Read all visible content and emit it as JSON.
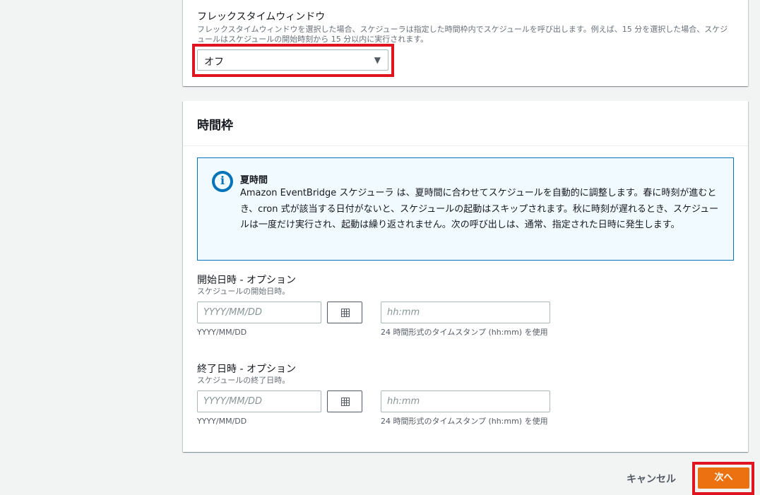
{
  "flex_window": {
    "label": "フレックスタイムウィンドウ",
    "description": "フレックスタイムウィンドウを選択した場合、スケジューラは指定した時間枠内でスケジュールを呼び出します。例えば、15 分を選択した場合、スケジュールはスケジュールの開始時刻から 15 分以内に実行されます。",
    "selected_value": "オフ",
    "caret_icon": "caret-down-icon"
  },
  "time_frame": {
    "title": "時間枠",
    "alert": {
      "icon": "info-icon",
      "icon_glyph": "i",
      "title": "夏時間",
      "body": "Amazon EventBridge スケジューラ は、夏時間に合わせてスケジュールを自動的に調整します。春に時刻が進むとき、cron 式が該当する日付がないと、スケジュールの起動はスキップされます。秋に時刻が遅れるとき、スケジュールは一度だけ実行され、起動は繰り返されません。次の呼び出しは、通常、指定された日時に発生します。"
    },
    "start": {
      "label": "開始日時 - オプション",
      "description": "スケジュールの開始日時。",
      "date_placeholder": "YYYY/MM/DD",
      "date_hint": "YYYY/MM/DD",
      "time_placeholder": "hh:mm",
      "time_hint": "24 時間形式のタイムスタンプ (hh:mm) を使用"
    },
    "end": {
      "label": "終了日時 - オプション",
      "description": "スケジュールの終了日時。",
      "date_placeholder": "YYYY/MM/DD",
      "date_hint": "YYYY/MM/DD",
      "time_placeholder": "hh:mm",
      "time_hint": "24 時間形式のタイムスタンプ (hh:mm) を使用"
    }
  },
  "footer": {
    "cancel_label": "キャンセル",
    "next_label": "次へ"
  },
  "colors": {
    "accent": "#ec7211",
    "highlight": "#e0141e",
    "info": "#0073bb"
  }
}
